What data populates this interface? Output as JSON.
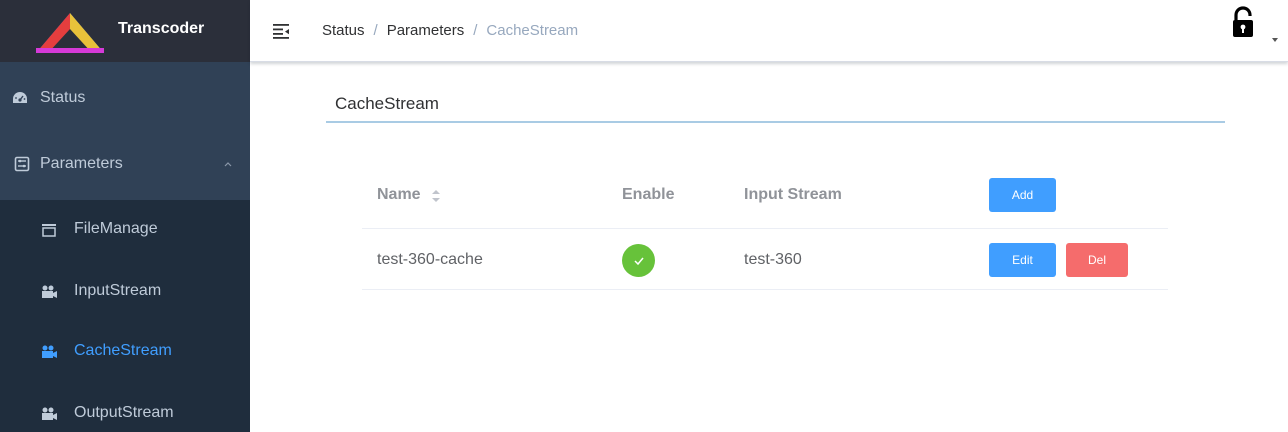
{
  "app": {
    "title": "Transcoder"
  },
  "sidebar": {
    "items": [
      {
        "label": "Status",
        "icon": "dashboard-icon"
      },
      {
        "label": "Parameters",
        "icon": "parameters-icon",
        "expanded": true
      }
    ],
    "submenu": [
      {
        "label": "FileManage",
        "icon": "folder-icon"
      },
      {
        "label": "InputStream",
        "icon": "camera-icon"
      },
      {
        "label": "CacheStream",
        "icon": "camera-icon",
        "active": true
      },
      {
        "label": "OutputStream",
        "icon": "camera-icon"
      }
    ]
  },
  "header": {
    "breadcrumb": [
      "Status",
      "Parameters",
      "CacheStream"
    ],
    "separator": "/",
    "icons": [
      "hamburger-icon",
      "lock-icon",
      "caret-down-icon"
    ]
  },
  "main": {
    "title": "CacheStream",
    "table": {
      "columns": [
        "Name",
        "Enable",
        "Input Stream"
      ],
      "add_label": "Add",
      "rows": [
        {
          "name": "test-360-cache",
          "enabled": true,
          "input_stream": "test-360",
          "edit_label": "Edit",
          "del_label": "Del"
        }
      ]
    }
  },
  "colors": {
    "sidebar_bg": "#304156",
    "submenu_bg": "#1f2d3d",
    "active": "#409eff",
    "primary_button": "#409eff",
    "danger_button": "#f56c6c",
    "success": "#67c23a"
  }
}
